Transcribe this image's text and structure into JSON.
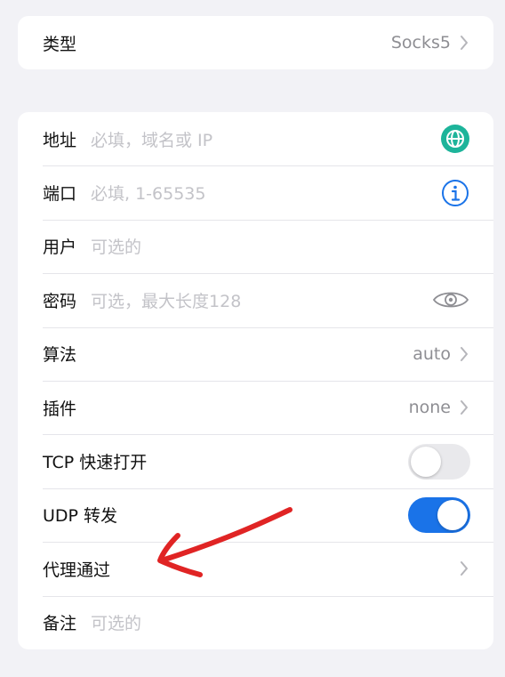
{
  "type_row": {
    "label": "类型",
    "value": "Socks5"
  },
  "fields": {
    "address": {
      "label": "地址",
      "placeholder": "必填，域名或 IP"
    },
    "port": {
      "label": "端口",
      "placeholder": "必填, 1-65535"
    },
    "user": {
      "label": "用户",
      "placeholder": "可选的"
    },
    "password": {
      "label": "密码",
      "placeholder": "可选，最大长度128"
    },
    "algorithm": {
      "label": "算法",
      "value": "auto"
    },
    "plugin": {
      "label": "插件",
      "value": "none"
    },
    "tcp_fast_open": {
      "label": "TCP 快速打开",
      "enabled": false
    },
    "udp_relay": {
      "label": "UDP 转发",
      "enabled": true
    },
    "proxy_via": {
      "label": "代理通过"
    },
    "note": {
      "label": "备注",
      "placeholder": "可选的"
    }
  },
  "colors": {
    "accent": "#1a73e8",
    "globe_icon": "#1db49a",
    "annotation_arrow": "#e02424"
  },
  "icons": {
    "address": "globe-icon",
    "port": "info-icon",
    "password": "eye-icon",
    "chevron": "chevron-right-icon"
  }
}
